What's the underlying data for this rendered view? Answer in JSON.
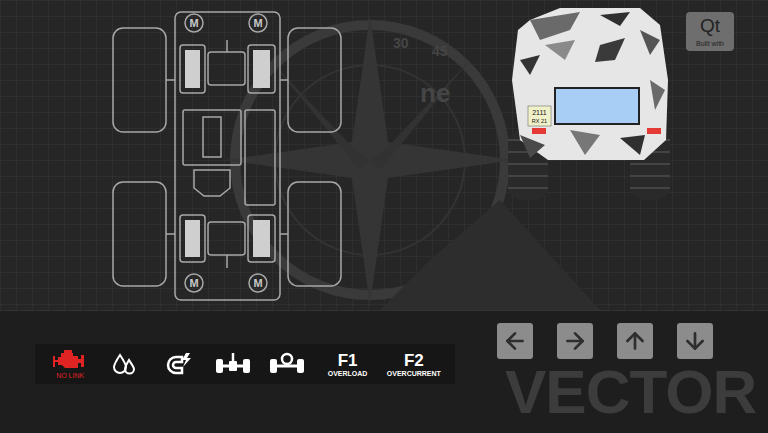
{
  "logo": {
    "title": "Qt",
    "caption": "Built with"
  },
  "watermark": {
    "brand": "VECTOR",
    "compass_labels": [
      "30",
      "45",
      "ne"
    ]
  },
  "chassis": {
    "motors": [
      {
        "label": "M"
      },
      {
        "label": "M"
      },
      {
        "label": "M"
      },
      {
        "label": "M"
      }
    ]
  },
  "vehicle": {
    "plate": [
      "2111",
      "RX 21"
    ]
  },
  "status_indicators": [
    {
      "kind": "engine",
      "label": "NO LINK",
      "alert": true
    },
    {
      "kind": "fluid",
      "label": "",
      "alert": false
    },
    {
      "kind": "magnet",
      "label": "",
      "alert": false
    },
    {
      "kind": "axlefront",
      "label": "",
      "alert": false
    },
    {
      "kind": "axlerear",
      "label": "",
      "alert": false
    },
    {
      "kind": "fault",
      "code": "F1",
      "label": "OVERLOAD",
      "alert": false
    },
    {
      "kind": "fault",
      "code": "F2",
      "label": "OVERCURRENT",
      "alert": false
    }
  ],
  "controls": [
    {
      "kind": "left"
    },
    {
      "kind": "right"
    },
    {
      "kind": "up"
    },
    {
      "kind": "down"
    }
  ]
}
